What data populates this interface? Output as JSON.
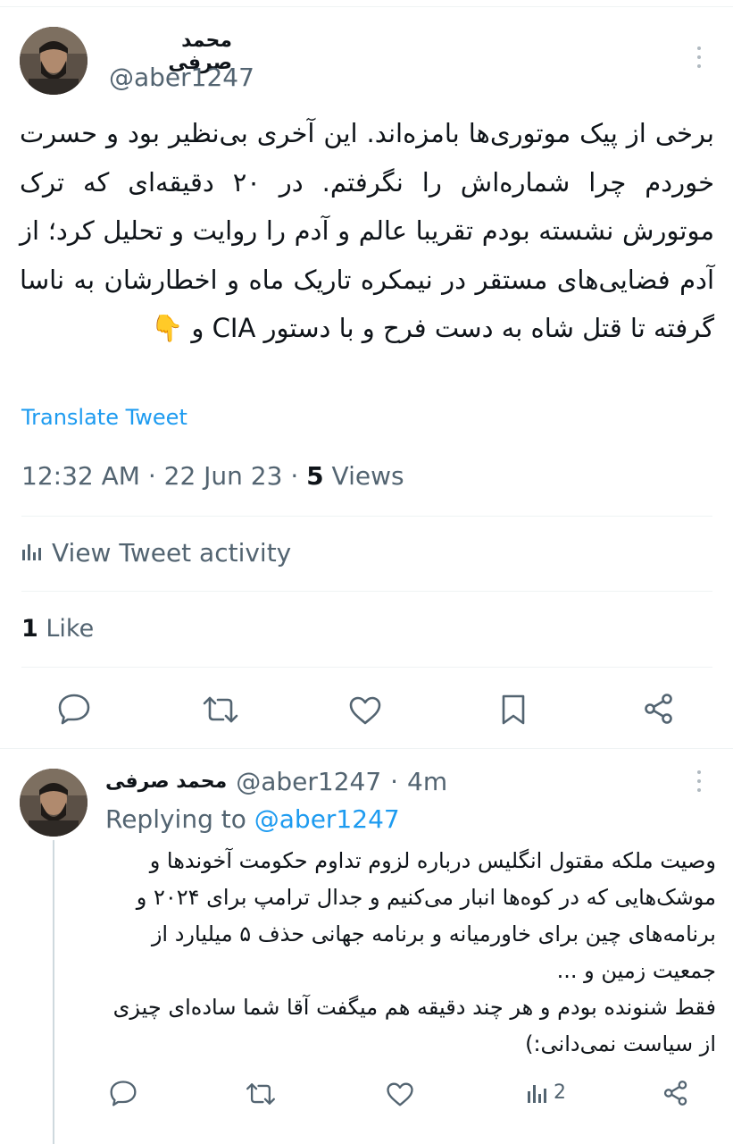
{
  "tweet": {
    "author_name": "محمد صرفی",
    "author_handle": "@aber1247",
    "text": "برخی از پیک موتوری‌ها بامزه‌اند. این آخری بی‌نظیر بود و حسرت خوردم چرا شماره‌اش را نگرفتم. در ۲۰ دقیقه‌ای که ترک موتورش نشسته بودم تقریبا عالم و آدم را روایت و تحلیل کرد؛ از آدم فضایی‌های مستقر در نیمکره تاریک ماه و اخطارشان به ناسا گرفته تا قتل شاه به دست فرح و با دستور CIA و 👇",
    "translate_label": "Translate Tweet",
    "time": "12:32 AM",
    "date": "22 Jun 23",
    "views_count": "5",
    "views_label": "Views",
    "activity_label": "View Tweet activity",
    "likes_count": "1",
    "likes_label": "Like"
  },
  "reply": {
    "author_name": "محمد صرفی",
    "author_handle": "@aber1247",
    "age": "4m",
    "replying_label": "Replying to",
    "replying_to": "@aber1247",
    "paragraphs": [
      "وصیت ملکه مقتول انگلیس درباره لزوم تداوم حکومت آخوندها و موشک‌هایی که در کوه‌ها انبار می‌کنیم و جدال ترامپ برای ۲۰۲۴ و برنامه‌های چین برای خاورمیانه و برنامه جهانی حذف ۵ میلیارد از جمعیت زمین و ...",
      "فقط شنونده بودم و هر چند دقیقه هم میگفت آقا شما ساده‌ای چیزی از سیاست نمی‌دانی:)"
    ],
    "views_count": "2"
  },
  "separator": "·",
  "icons": {
    "more": "more-vertical-icon",
    "reply": "reply-icon",
    "retweet": "retweet-icon",
    "like": "heart-icon",
    "bookmark": "bookmark-icon",
    "share": "share-icon",
    "activity": "analytics-icon"
  },
  "colors": {
    "link": "#1d9bf0",
    "secondary_text": "#536471",
    "primary_text": "#0f1419",
    "divider": "#eff3f4"
  }
}
